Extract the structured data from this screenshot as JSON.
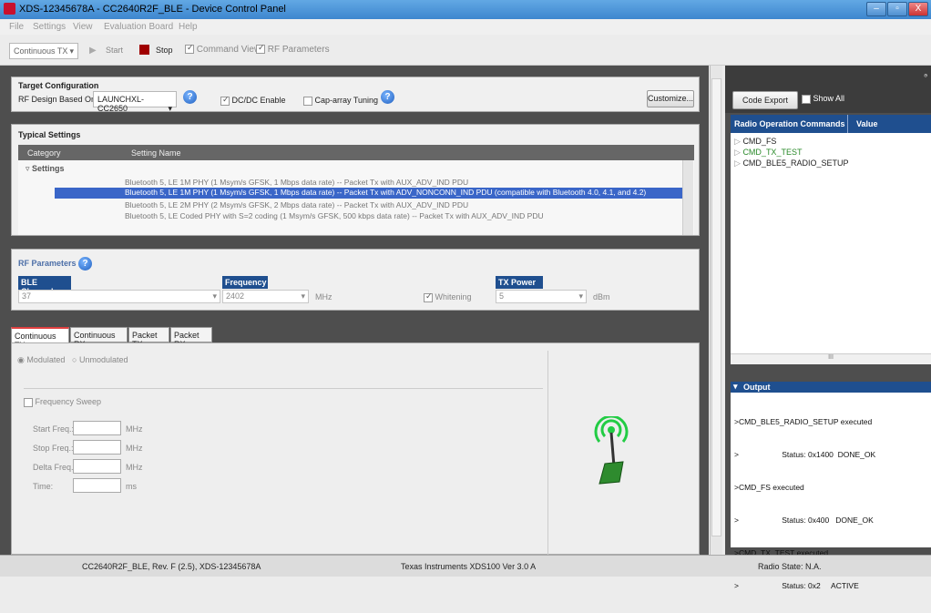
{
  "window": {
    "title": "XDS-12345678A - CC2640R2F_BLE - Device Control Panel",
    "min": "–",
    "max": "▫",
    "close": "X"
  },
  "menu": [
    "File",
    "Settings",
    "View",
    "Evaluation Board",
    "Help"
  ],
  "toolbar": {
    "mode": "Continuous TX",
    "start": "Start",
    "stop": "Stop",
    "command_view": "Command View",
    "rf_parameters": "RF Parameters"
  },
  "target": {
    "header": "Target Configuration",
    "rf_label": "RF Design Based On:",
    "rf_value": "LAUNCHXL-CC2650",
    "dcdc": "DC/DC Enable",
    "caparray": "Cap-array Tuning",
    "customize": "Customize..."
  },
  "typical": {
    "header": "Typical Settings",
    "col_category": "Category",
    "col_setting": "Setting Name",
    "group": "Settings",
    "rows": [
      "Bluetooth 5, LE 1M PHY (1 Msym/s GFSK, 1 Mbps data rate) -- Packet Tx with AUX_ADV_IND PDU",
      "Bluetooth 5, LE 1M PHY (1 Msym/s GFSK, 1 Mbps data rate) -- Packet Tx with ADV_NONCONN_IND PDU (compatible with Bluetooth 4.0, 4.1, and 4.2)",
      "Bluetooth 5, LE 2M PHY (2 Msym/s GFSK, 2 Mbps  data rate) -- Packet Tx with AUX_ADV_IND PDU",
      "Bluetooth 5, LE Coded PHY with S=2 coding (1 Msym/s GFSK, 500 kbps data rate) -- Packet Tx with AUX_ADV_IND PDU"
    ]
  },
  "rf": {
    "header": "RF Parameters",
    "ch_label": "BLE Channel",
    "ch_value": "37",
    "freq_label": "Frequency",
    "freq_value": "2402",
    "freq_unit": "MHz",
    "whitening": "Whitening",
    "tx_label": "TX Power",
    "tx_value": "5",
    "tx_unit": "dBm"
  },
  "tabs": [
    "Continuous TX",
    "Continuous RX",
    "Packet TX",
    "Packet RX"
  ],
  "ctx": {
    "modulated": "Modulated",
    "unmodulated": "Unmodulated",
    "sweep": "Frequency Sweep",
    "start": "Start Freq.:",
    "stop": "Stop Freq.:",
    "delta": "Delta Freq.:",
    "time": "Time:",
    "mhz": "MHz",
    "ms": "ms"
  },
  "right": {
    "code_export": "Code Export",
    "show_all": "Show All",
    "col_cmd": "Radio Operation Commands",
    "col_val": "Value",
    "cmds": [
      "CMD_FS",
      "CMD_TX_TEST",
      "CMD_BLE5_RADIO_SETUP"
    ],
    "scroll_mark": "III",
    "pin": "ₔ"
  },
  "output": {
    "header": "Output",
    "lines": [
      ">CMD_BLE5_RADIO_SETUP executed",
      ">                    Status: 0x1400  DONE_OK",
      ">CMD_FS executed",
      ">                    Status: 0x400   DONE_OK",
      ">CMD_TX_TEST executed",
      ">                    Status: 0x2     ACTIVE"
    ]
  },
  "status": {
    "left": "CC2640R2F_BLE, Rev. F (2.5), XDS-12345678A",
    "center": "Texas Instruments XDS100 Ver 3.0 A",
    "right": "Radio State: N.A."
  },
  "colors": {
    "selection": "#3a66c8",
    "field_header": "#1f4f8f",
    "active_cmd": "#2a8a2a",
    "stop": "#a00000"
  }
}
